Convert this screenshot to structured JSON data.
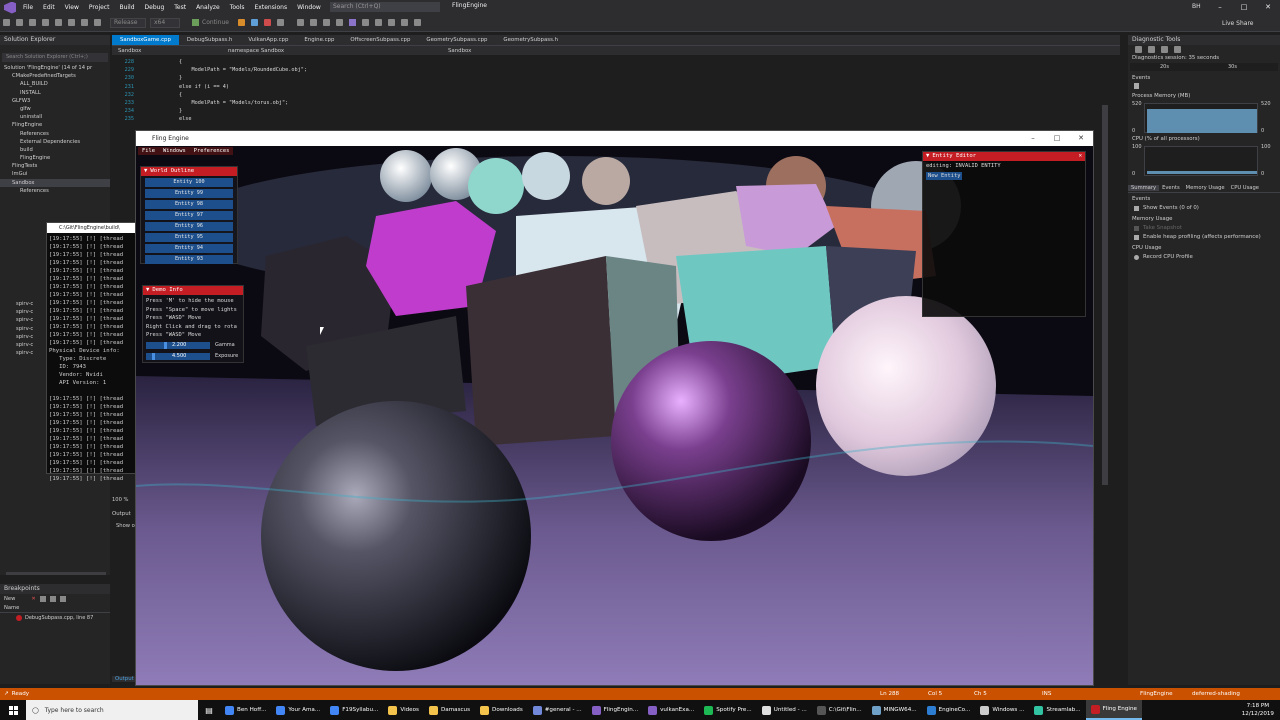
{
  "menubar": {
    "items": [
      "File",
      "Edit",
      "View",
      "Project",
      "Build",
      "Debug",
      "Test",
      "Analyze",
      "Tools",
      "Extensions",
      "Window",
      "Help"
    ],
    "search_placeholder": "Search (Ctrl+Q)",
    "solution_name": "FlingEngine",
    "user_initials": "BH",
    "live_share": "Live Share"
  },
  "toolbar": {
    "config": "Release",
    "platform": "x64",
    "continue_label": "Continue"
  },
  "solution_explorer": {
    "title": "Solution Explorer",
    "search_placeholder": "Search Solution Explorer (Ctrl+;)",
    "items": [
      "Solution 'FlingEngine' (14 of 14 pr",
      "CMakePredefinedTargets",
      "ALL_BUILD",
      "INSTALL",
      "GLFW3",
      "glfw",
      "uninstall",
      "FlingEngine",
      "References",
      "External Dependencies",
      "build",
      "FlingEngine",
      "FlingTests",
      "ImGui",
      "Sandbox",
      "References"
    ]
  },
  "breakpoints": {
    "title": "Breakpoints",
    "new_label": "New",
    "col_name": "Name",
    "item": "DebugSubpass.cpp, line 87"
  },
  "editor": {
    "tabs": [
      "SandboxGame.cpp",
      "DebugSubpass.h",
      "VulkanApp.cpp",
      "Engine.cpp",
      "OffscreenSubpass.cpp",
      "GeometrySubpass.cpp",
      "GeometrySubpass.h"
    ],
    "nav_project": "Sandbox",
    "nav_scope": "namespace Sandbox",
    "nav_func": "Sandbox",
    "lines": [
      {
        "n": "228",
        "t": "        {"
      },
      {
        "n": "229",
        "t": "            ModelPath = \"Models/RoundedCube.obj\";"
      },
      {
        "n": "230",
        "t": "        }"
      },
      {
        "n": "231",
        "t": "        else if (i == 4)"
      },
      {
        "n": "232",
        "t": "        {"
      },
      {
        "n": "233",
        "t": "            ModelPath = \"Models/torus.obj\";"
      },
      {
        "n": "234",
        "t": "        }"
      },
      {
        "n": "235",
        "t": "        else"
      }
    ],
    "zoom": "100 %",
    "output_title": "Output",
    "output_show": "Show o",
    "output_tab": "Output"
  },
  "diagnostics": {
    "title": "Diagnostic Tools",
    "session": "Diagnostics session: 35 seconds",
    "tick1": "20s",
    "tick2": "30s",
    "events": "Events",
    "process_memory": "Process Memory (MB)",
    "mem_max": "520",
    "mem_min": "0",
    "cpu": "CPU (% of all processors)",
    "cpu_max": "100",
    "cpu_min": "0",
    "tabs": [
      "Summary",
      "Events",
      "Memory Usage",
      "CPU Usage"
    ],
    "events_label": "Events",
    "show_events": "Show Events (0 of 0)",
    "memory_usage": "Memory Usage",
    "take_snapshot": "Take Snapshot",
    "heap_profiling": "Enable heap profiling (affects performance)",
    "cpu_usage": "CPU Usage",
    "record_cpu": "Record CPU Profile"
  },
  "console": {
    "title": "C:\\Git\\FlingEngine\\build\\",
    "lines": [
      "[19:17:55] [!] [thread",
      "[19:17:55] [!] [thread",
      "[19:17:55] [!] [thread",
      "[19:17:55] [!] [thread",
      "[19:17:55] [!] [thread",
      "[19:17:55] [!] [thread",
      "[19:17:55] [!] [thread",
      "[19:17:55] [!] [thread",
      "[19:17:55] [!] [thread",
      "[19:17:55] [!] [thread",
      "[19:17:55] [!] [thread",
      "[19:17:55] [!] [thread",
      "[19:17:55] [!] [thread",
      "[19:17:55] [!] [thread",
      "Physical Device info:",
      "   Type: Discrete",
      "   ID: 7943",
      "   Vendor: Nvidi",
      "   API Version: 1",
      "",
      "[19:17:55] [!] [thread",
      "[19:17:55] [!] [thread",
      "[19:17:55] [!] [thread",
      "[19:17:55] [!] [thread",
      "[19:17:55] [!] [thread",
      "[19:17:55] [!] [thread",
      "[19:17:55] [!] [thread",
      "[19:17:55] [!] [thread",
      "[19:17:55] [!] [thread",
      "[19:17:55] [!] [thread",
      "[19:17:55] [!] [thread"
    ]
  },
  "fling": {
    "title": "Fling Engine",
    "menu": [
      "File",
      "Windows",
      "Preferences"
    ],
    "world_outline": {
      "title": "World Outline",
      "entities": [
        "Entity 100",
        "Entity 99",
        "Entity 98",
        "Entity 97",
        "Entity 96",
        "Entity 95",
        "Entity 94",
        "Entity 93"
      ]
    },
    "demo_info": {
      "title": "Demo Info",
      "lines": [
        "Press 'M' to hide the mouse",
        "Press \"Space\" to move lights",
        "Press \"WASD\" Move",
        "Right Click and drag to rota",
        "Press \"WASD\" Move"
      ],
      "gamma_value": "2.200",
      "gamma_label": "Gamma",
      "gamma_fill": 0.3,
      "exposure_value": "4.500",
      "exposure_label": "Exposure",
      "exposure_fill": 0.1
    },
    "entity_editor": {
      "title": "Entity Editor",
      "editing": "editing: INVALID ENTITY",
      "new_entity": "New Entity"
    }
  },
  "statusbar": {
    "ready": "Ready",
    "ln": "Ln 288",
    "col": "Col 5",
    "ch": "Ch 5",
    "ins": "INS",
    "repo": "FlingEngine",
    "branch": "deferred-shading"
  },
  "taskbar": {
    "search_placeholder": "Type here to search",
    "items": [
      {
        "label": "Ben Hoff...",
        "color": "#4285f4"
      },
      {
        "label": "Your Ama...",
        "color": "#4285f4"
      },
      {
        "label": "F19Syllabu...",
        "color": "#4285f4"
      },
      {
        "label": "Videos",
        "color": "#f4c34b"
      },
      {
        "label": "Damascus",
        "color": "#f4c34b"
      },
      {
        "label": "Downloads",
        "color": "#f4c34b"
      },
      {
        "label": "#general - ...",
        "color": "#7289da"
      },
      {
        "label": "FlingEngin...",
        "color": "#865fc5"
      },
      {
        "label": "vulkanExa...",
        "color": "#865fc5"
      },
      {
        "label": "Spotify Pre...",
        "color": "#1db954"
      },
      {
        "label": "Untitled - ...",
        "color": "#e0e0e0"
      },
      {
        "label": "C:\\Git\\Flin...",
        "color": "#555555"
      },
      {
        "label": "MINGW64...",
        "color": "#6fa0c8"
      },
      {
        "label": "EngineCo...",
        "color": "#2d7dd2"
      },
      {
        "label": "Windows ...",
        "color": "#cccccc"
      },
      {
        "label": "Streamlab...",
        "color": "#31c3a2"
      },
      {
        "label": "Fling Engine",
        "color": "#c41e24"
      }
    ],
    "time": "7:18 PM",
    "date": "12/12/2019"
  }
}
